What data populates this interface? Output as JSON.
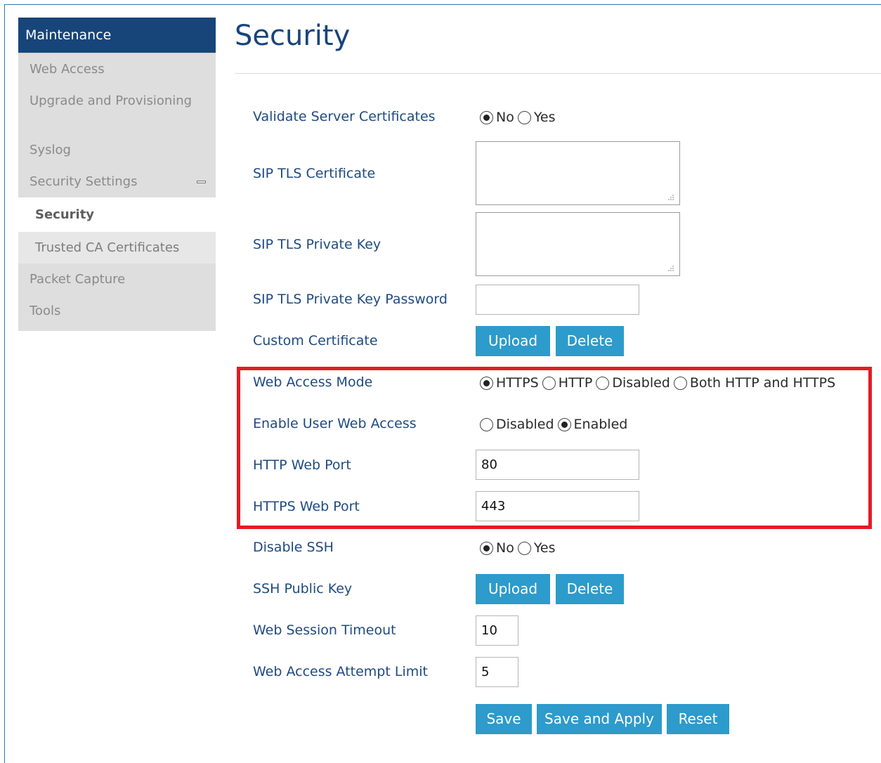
{
  "sidebar": {
    "header": "Maintenance",
    "items": [
      {
        "label": "Web Access"
      },
      {
        "label": "Upgrade and Provisioning"
      },
      {
        "label": "Syslog"
      },
      {
        "label": "Security Settings",
        "icon": "collapse-icon"
      },
      {
        "label": "Security",
        "active": true
      },
      {
        "label": "Trusted CA Certificates"
      },
      {
        "label": "Packet Capture"
      },
      {
        "label": "Tools"
      }
    ]
  },
  "page": {
    "title": "Security"
  },
  "form": {
    "validate_server_certs": {
      "label": "Validate Server Certificates",
      "options": [
        "No",
        "Yes"
      ],
      "selected": "No"
    },
    "sip_tls_certificate": {
      "label": "SIP TLS Certificate",
      "value": ""
    },
    "sip_tls_private_key": {
      "label": "SIP TLS Private Key",
      "value": ""
    },
    "sip_tls_private_key_password": {
      "label": "SIP TLS Private Key Password",
      "value": ""
    },
    "custom_certificate": {
      "label": "Custom Certificate",
      "upload": "Upload",
      "delete": "Delete"
    },
    "web_access_mode": {
      "label": "Web Access Mode",
      "options": [
        "HTTPS",
        "HTTP",
        "Disabled",
        "Both HTTP and HTTPS"
      ],
      "selected": "HTTPS"
    },
    "enable_user_web_access": {
      "label": "Enable User Web Access",
      "options": [
        "Disabled",
        "Enabled"
      ],
      "selected": "Enabled"
    },
    "http_web_port": {
      "label": "HTTP Web Port",
      "value": "80"
    },
    "https_web_port": {
      "label": "HTTPS Web Port",
      "value": "443"
    },
    "disable_ssh": {
      "label": "Disable SSH",
      "options": [
        "No",
        "Yes"
      ],
      "selected": "No"
    },
    "ssh_public_key": {
      "label": "SSH Public Key",
      "upload": "Upload",
      "delete": "Delete"
    },
    "web_session_timeout": {
      "label": "Web Session Timeout",
      "value": "10"
    },
    "web_access_attempt_limit": {
      "label": "Web Access Attempt Limit",
      "value": "5"
    }
  },
  "actions": {
    "save": "Save",
    "save_apply": "Save and Apply",
    "reset": "Reset"
  },
  "colors": {
    "header": "#17457a",
    "button": "#2d9bcb",
    "highlight": "#e31c24",
    "label": "#1f4a80"
  }
}
